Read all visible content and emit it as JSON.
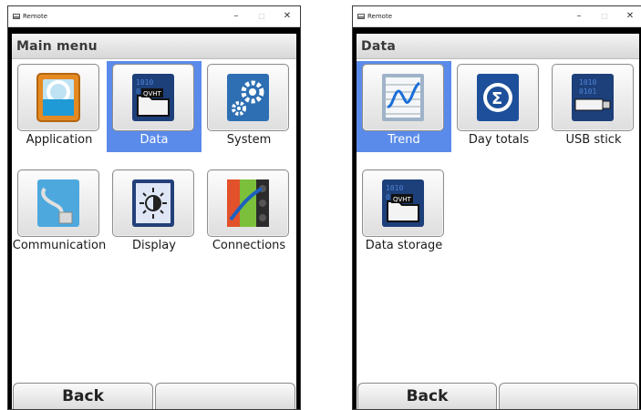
{
  "colors": {
    "selection": "#5b8bea",
    "frame": "#000000",
    "header_text": "#3a3a3a"
  },
  "windows": [
    {
      "title": "Remote",
      "controls": {
        "minimize": "–",
        "maximize": "□",
        "close": "✕"
      },
      "header": "Main menu",
      "tiles": [
        {
          "label": "Application",
          "icon": "application-icon",
          "selected": false
        },
        {
          "label": "Data",
          "icon": "data-folder-icon",
          "selected": true
        },
        {
          "label": "System",
          "icon": "gears-icon",
          "selected": false
        },
        {
          "label": "Communication",
          "icon": "cable-plug-icon",
          "selected": false
        },
        {
          "label": "Display",
          "icon": "brightness-icon",
          "selected": false
        },
        {
          "label": "Connections",
          "icon": "terminal-connections-icon",
          "selected": false
        }
      ],
      "softkeys": [
        "Back",
        ""
      ]
    },
    {
      "title": "Remote",
      "controls": {
        "minimize": "–",
        "maximize": "□",
        "close": "✕"
      },
      "header": "Data",
      "tiles": [
        {
          "label": "Trend",
          "icon": "trend-chart-icon",
          "selected": true
        },
        {
          "label": "Day totals",
          "icon": "sigma-icon",
          "selected": false
        },
        {
          "label": "USB stick",
          "icon": "usb-stick-icon",
          "selected": false
        },
        {
          "label": "Data storage",
          "icon": "data-folder-icon",
          "selected": false
        }
      ],
      "softkeys": [
        "Back",
        ""
      ]
    }
  ]
}
